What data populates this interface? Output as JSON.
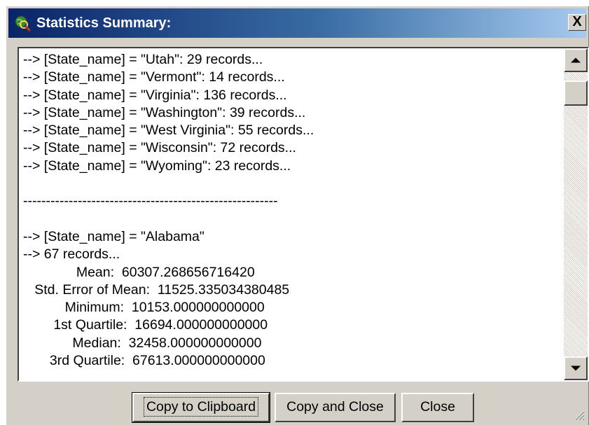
{
  "window": {
    "title": "Statistics Summary:",
    "close_label": "X",
    "icon": "globe-magnifier-icon"
  },
  "output_lines": [
    "--> [State_name] = \"Utah\": 29 records...",
    "--> [State_name] = \"Vermont\": 14 records...",
    "--> [State_name] = \"Virginia\": 136 records...",
    "--> [State_name] = \"Washington\": 39 records...",
    "--> [State_name] = \"West Virginia\": 55 records...",
    "--> [State_name] = \"Wisconsin\": 72 records...",
    "--> [State_name] = \"Wyoming\": 23 records...",
    "",
    "--------------------------------------------------------",
    "",
    "--> [State_name] = \"Alabama\"",
    "--> 67 records...",
    "              Mean:  60307.268656716420",
    "   Std. Error of Mean:  11525.335034380485",
    "           Minimum:  10153.000000000000",
    "        1st Quartile:  16694.000000000000",
    "             Median:  32458.000000000000",
    "       3rd Quartile:  67613.000000000000"
  ],
  "buttons": {
    "copy_to_clipboard": "Copy to Clipboard",
    "copy_and_close": "Copy and Close",
    "close": "Close"
  },
  "colors": {
    "title_bar_start": "#0a246a",
    "title_bar_end": "#a6caf0",
    "dialog_face": "#d4d0c8"
  }
}
